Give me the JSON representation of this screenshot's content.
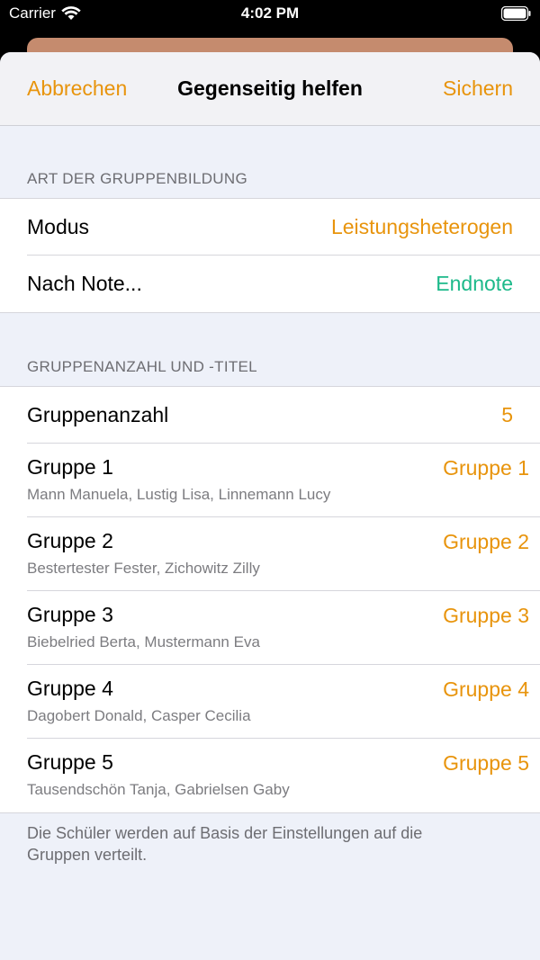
{
  "status_bar": {
    "carrier": "Carrier",
    "time": "4:02 PM"
  },
  "nav": {
    "cancel_label": "Abbrechen",
    "title": "Gegenseitig helfen",
    "save_label": "Sichern"
  },
  "section1": {
    "header": "ART DER GRUPPENBILDUNG",
    "rows": [
      {
        "label": "Modus",
        "value": "Leistungsheterogen"
      },
      {
        "label": "Nach Note...",
        "value": "Endnote"
      }
    ]
  },
  "section2": {
    "header": "GRUPPENANZAHL UND -TITEL",
    "count_label": "Gruppenanzahl",
    "count_value": "5",
    "groups": [
      {
        "label": "Gruppe 1",
        "members": "Mann Manuela, Lustig Lisa, Linnemann Lucy",
        "title": "Gruppe 1"
      },
      {
        "label": "Gruppe 2",
        "members": "Bestertester Fester, Zichowitz Zilly",
        "title": "Gruppe 2"
      },
      {
        "label": "Gruppe 3",
        "members": "Biebelried Berta, Mustermann Eva",
        "title": "Gruppe 3"
      },
      {
        "label": "Gruppe 4",
        "members": "Dagobert Donald, Casper Cecilia",
        "title": "Gruppe 4"
      },
      {
        "label": "Gruppe 5",
        "members": "Tausendschön Tanja, Gabrielsen Gaby",
        "title": "Gruppe 5"
      }
    ],
    "footer": "Die Schüler werden auf Basis der Einstellungen auf die Gruppen verteilt."
  },
  "colors": {
    "accent": "#e8940c",
    "green": "#1cb98a"
  }
}
